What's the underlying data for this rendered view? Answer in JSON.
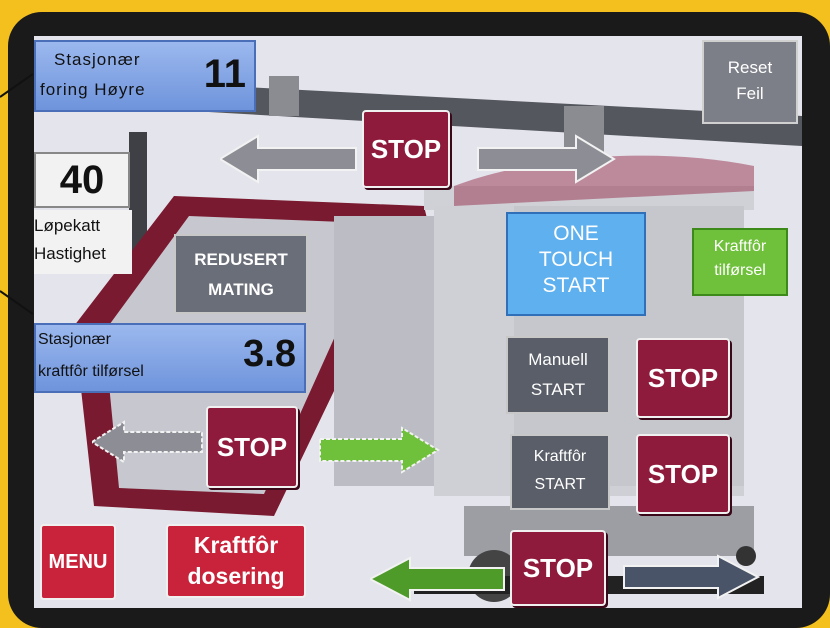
{
  "colors": {
    "stop": "#8e1b3c",
    "blue_panel": "#7fa2e4",
    "light_blue": "#5fb0ee",
    "green": "#6fc03a",
    "gray_button": "#5a5e68",
    "menu_red": "#c8233a"
  },
  "stationary_feed_right": {
    "label_line1": "Stasjonær",
    "label_line2": "foring Høyre",
    "value": "11"
  },
  "reset_error": {
    "line1": "Reset",
    "line2": "Feil"
  },
  "trolley_speed": {
    "value": "40",
    "label_line1": "Løpekatt",
    "label_line2": "Hastighet"
  },
  "reduced_feed": {
    "line1": "REDUSERT",
    "line2": "MATING"
  },
  "stationary_concentrate": {
    "label_line1": "Stasjonær",
    "label_line2": "kraftfôr tilførsel",
    "value": "3.8"
  },
  "one_touch": {
    "line1": "ONE",
    "line2": "TOUCH",
    "line3": "START"
  },
  "concentrate_supply": {
    "line1": "Kraftfôr",
    "line2": "tilførsel"
  },
  "manual_start": {
    "line1": "Manuell",
    "line2": "START"
  },
  "concentrate_start": {
    "line1": "Kraftfôr",
    "line2": "START"
  },
  "stop_label": "STOP",
  "menu_label": "MENU",
  "concentrate_dosing": {
    "line1": "Kraftfôr",
    "line2": "dosering"
  },
  "arrows": {
    "top_left": "left-arrow-icon",
    "top_right": "right-arrow-icon",
    "mid_left": "left-arrow-icon",
    "mid_right": "right-arrow-icon",
    "bottom_left": "left-arrow-icon",
    "bottom_right": "right-arrow-icon"
  }
}
